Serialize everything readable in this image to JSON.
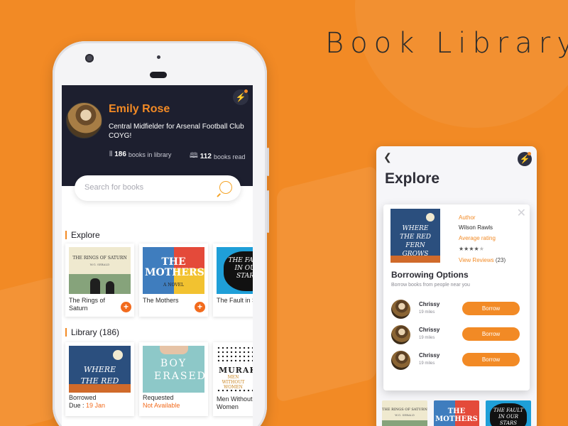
{
  "hero_title": "Book Library",
  "colors": {
    "background": "#f28a25",
    "accent": "#f28a25",
    "profile_bg": "#1d1f2f",
    "warning_text": "#f26b1d"
  },
  "profile": {
    "name": "Emily Rose",
    "bio": "Central Midfielder for Arsenal Football Club COYG!",
    "books_in_library_count": "186",
    "books_in_library_label": "books in library",
    "books_read_count": "112",
    "books_read_label": "books read",
    "library_icon": "books-icon",
    "read_icon": "open-book-icon",
    "notification_icon": "lightning-bolt-icon"
  },
  "search": {
    "placeholder": "Search for books",
    "icon": "search-icon"
  },
  "explore_section": {
    "title": "Explore",
    "books": [
      {
        "title": "The Rings of Saturn",
        "cover_text": "THE RINGS OF SATURN",
        "cover_author": "W.G. SEBALD"
      },
      {
        "title": "The Mothers",
        "cover_text": "THE MOTHERS",
        "cover_sub": "A NOVEL"
      },
      {
        "title": "The Fault in Stars",
        "cover_text": "THE FAULT IN OUR STARS"
      }
    ]
  },
  "library_section": {
    "title": "Library (186)",
    "books": [
      {
        "title": "Where the Red Fern",
        "cover_text": "WHERE THE RED FERN",
        "status_label": "Borrowed",
        "status_line": "Due : ",
        "status_value": "19 Jan"
      },
      {
        "title": "Boy Erased",
        "cover_text": "BOY ERASED",
        "status_label": "Requested",
        "status_value": "Not Available"
      },
      {
        "title": "Men Without Women",
        "cover_text": "MURAKA",
        "cover_sub": "MEN WITHOUT WOMEN"
      }
    ]
  },
  "detail": {
    "back_icon": "chevron-left-icon",
    "notification_icon": "lightning-bolt-icon",
    "title": "Explore",
    "book": {
      "cover_text": "WHERE THE RED FERN GROWS",
      "author_label": "Author",
      "author": "Wilson Rawls",
      "rating_label": "Average rating",
      "rating": 4,
      "rating_max": 5,
      "reviews_link": "View Reviews",
      "reviews_count": "(23)"
    },
    "close_icon": "close-icon",
    "borrowing_title": "Borrowing Options",
    "borrowing_subtitle": "Borrow books from people near you",
    "lenders": [
      {
        "name": "Chrissy",
        "distance": "19 miles",
        "button": "Borrow"
      },
      {
        "name": "Chrissy",
        "distance": "19 miles",
        "button": "Borrow"
      },
      {
        "name": "Chrissy",
        "distance": "19 miles",
        "button": "Borrow"
      }
    ],
    "bottom_covers": [
      {
        "cover_text": "THE RINGS OF SATURN",
        "cover_author": "W.G. SEBALD"
      },
      {
        "cover_text": "THE MOTHERS"
      },
      {
        "cover_text": "THE FAULT IN OUR STARS"
      }
    ]
  }
}
